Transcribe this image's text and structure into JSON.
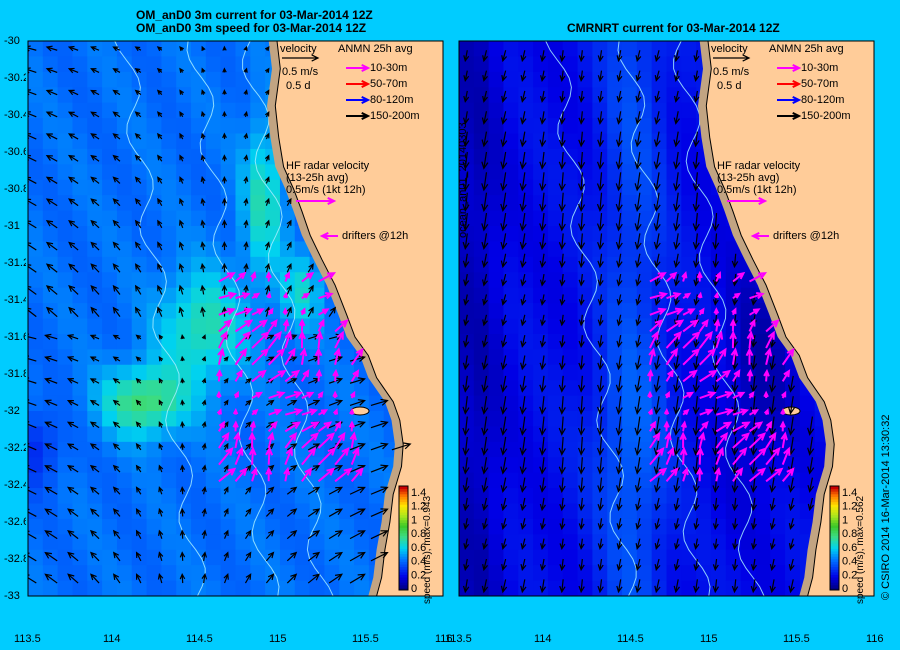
{
  "left_panel": {
    "title_line1": "OM_anD0 3m current for 03-Mar-2014 12Z",
    "title_line2": "OM_anD0 3m speed for 03-Mar-2014 12Z",
    "colorbar_label": "speed (m/s), max=0.943",
    "speed_max": 0.943
  },
  "right_panel": {
    "title": "CMRNRT current for 03-Mar-2014 12Z",
    "colorbar_label": "speed (m/s), max=0.562",
    "side_label": "ocean_an01_20140303",
    "speed_max": 0.562
  },
  "legend": {
    "velocity": "velocity",
    "scale_speed": "0.5 m/s",
    "scale_time": "0.5 d",
    "anmn_title": "ANMN 25h avg",
    "depths": [
      {
        "label": "10-30m",
        "color": "#ff00ff"
      },
      {
        "label": "50-70m",
        "color": "#ff0000"
      },
      {
        "label": "80-120m",
        "color": "#0000ff"
      },
      {
        "label": "150-200m",
        "color": "#000000"
      }
    ],
    "hf_line1": "HF radar velocity",
    "hf_line2": "(13-25h avg)",
    "hf_line3": "0.5m/s (1kt 12h)",
    "drifters": "drifters @12h"
  },
  "axes": {
    "lon_ticks": [
      "113.5",
      "114",
      "114.5",
      "115",
      "115.5",
      "116"
    ],
    "lat_ticks": [
      "-30",
      "-30.2",
      "-30.4",
      "-30.6",
      "-30.8",
      "-31",
      "-31.2",
      "-31.4",
      "-31.6",
      "-31.8",
      "-32",
      "-32.2",
      "-32.4",
      "-32.6",
      "-32.8",
      "-33"
    ],
    "colorbar_ticks": [
      "1.4",
      "1.2",
      "1",
      "0.8",
      "0.6",
      "0.4",
      "0.2",
      "0"
    ]
  },
  "credit": "© CSIRO 2014   16-Mar-2014 13:30:32",
  "colors": {
    "background": "#00ccff",
    "land": "#ffcc99",
    "shelf": "#c2a482",
    "hf_arrow": "#ff00ff"
  }
}
